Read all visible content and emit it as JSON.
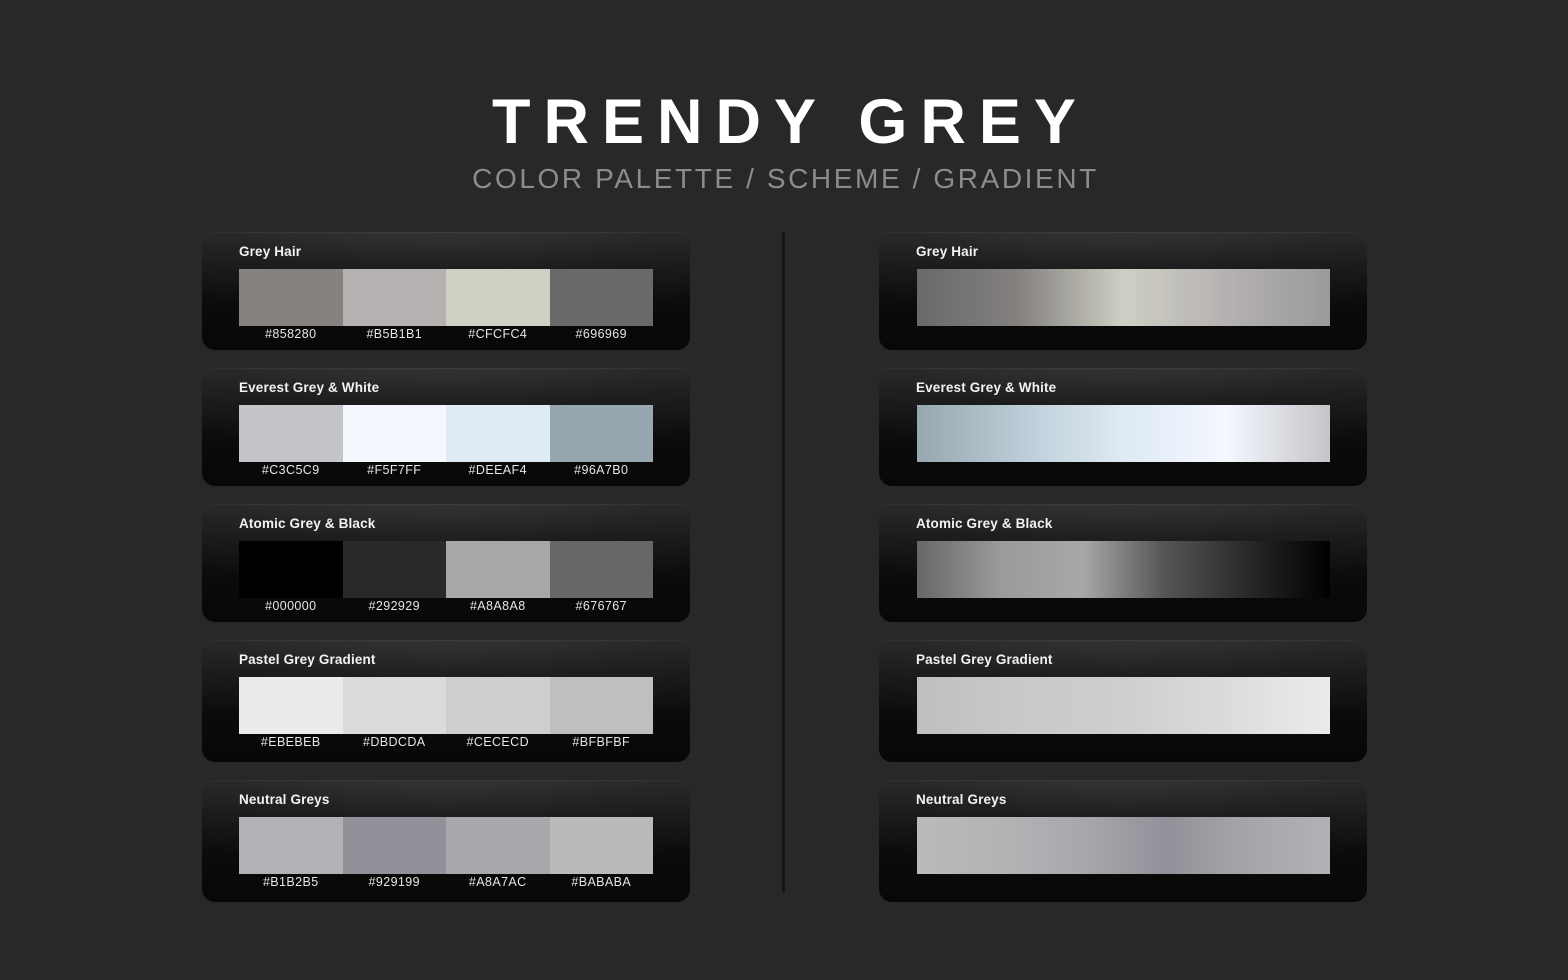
{
  "header": {
    "title": "TRENDY GREY",
    "subtitle": "COLOR PALETTE / SCHEME / GRADIENT"
  },
  "background_color": "#282828",
  "card_background": "#0b0b0b",
  "palettes": [
    {
      "name": "Grey Hair",
      "colors": [
        "#858280",
        "#B5B1B1",
        "#CFCFC4",
        "#696969"
      ],
      "gradient_stops": [
        "#696969",
        "#858280",
        "#CFCFC4",
        "#B5B1B1",
        "#9A9A9A"
      ],
      "gradient_direction": "to right"
    },
    {
      "name": "Everest Grey & White",
      "colors": [
        "#C3C5C9",
        "#F5F7FF",
        "#DEEAF4",
        "#96A7B0"
      ],
      "gradient_stops": [
        "#96A7B0",
        "#BCCCD6",
        "#DEEAF4",
        "#F5F7FF",
        "#C3C5C9"
      ],
      "gradient_direction": "to right"
    },
    {
      "name": "Atomic Grey & Black",
      "colors": [
        "#000000",
        "#292929",
        "#A8A8A8",
        "#676767"
      ],
      "gradient_stops": [
        "#676767",
        "#9A9A9A",
        "#A8A8A8",
        "#555555",
        "#292929",
        "#000000"
      ],
      "gradient_direction": "to right"
    },
    {
      "name": "Pastel Grey Gradient",
      "colors": [
        "#EBEBEB",
        "#DBDCDA",
        "#CECECD",
        "#BFBFBF"
      ],
      "gradient_stops": [
        "#BFBFBF",
        "#C9C9C8",
        "#CECECD",
        "#DBDCDA",
        "#EBEBEB"
      ],
      "gradient_direction": "to right"
    },
    {
      "name": "Neutral Greys",
      "colors": [
        "#B1B2B5",
        "#929199",
        "#A8A7AC",
        "#BABABA"
      ],
      "gradient_stops": [
        "#BABABA",
        "#B4B4B6",
        "#A8A7AC",
        "#929199",
        "#A5A5AB",
        "#B1B2B5"
      ],
      "gradient_direction": "to right"
    }
  ]
}
